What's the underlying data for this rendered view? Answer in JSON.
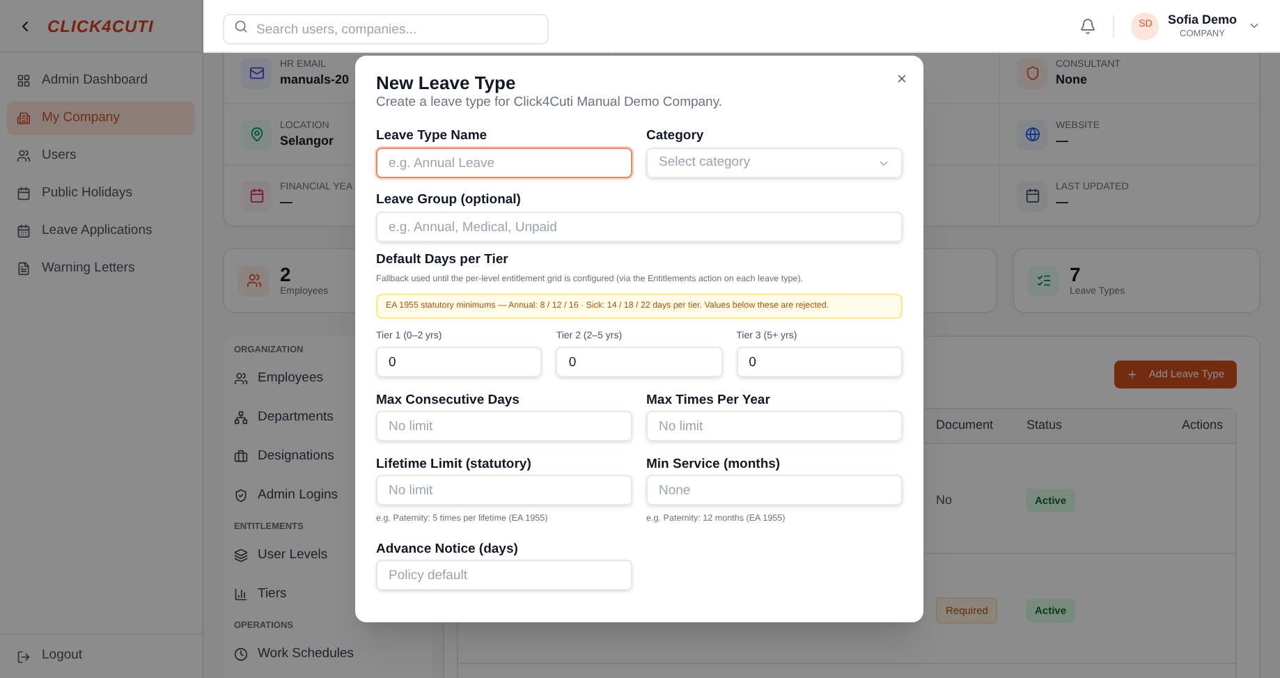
{
  "sidebar": {
    "logo": "CLICK4CUTI",
    "items": [
      {
        "label": "Admin Dashboard",
        "selected": false
      },
      {
        "label": "My Company",
        "selected": true
      },
      {
        "label": "Users",
        "selected": false
      },
      {
        "label": "Public Holidays",
        "selected": false
      },
      {
        "label": "Leave Applications",
        "selected": false
      },
      {
        "label": "Warning Letters",
        "selected": false
      }
    ],
    "logout": "Logout"
  },
  "topbar": {
    "search_placeholder": "Search users, companies...",
    "user": {
      "initials": "SD",
      "name": "Sofia Demo",
      "role": "COMPANY"
    }
  },
  "company_info": {
    "rows": [
      {
        "left": {
          "label": "HR EMAIL",
          "value": "manuals-20"
        },
        "right": {
          "label": "CONSULTANT",
          "value": "None"
        }
      },
      {
        "left": {
          "label": "LOCATION",
          "value": "Selangor"
        },
        "right": {
          "label": "WEBSITE",
          "value": "—"
        }
      },
      {
        "left": {
          "label": "FINANCIAL YEA",
          "value": "—"
        },
        "right": {
          "label": "LAST UPDATED",
          "value": "—"
        }
      }
    ]
  },
  "stats": [
    {
      "value": "2",
      "label": "Employees"
    },
    {
      "value": "7",
      "label": "Leave Types"
    }
  ],
  "settings_nav": [
    {
      "title": "ORGANIZATION",
      "items": [
        "Employees",
        "Departments",
        "Designations",
        "Admin Logins"
      ]
    },
    {
      "title": "ENTITLEMENTS",
      "items": [
        "User Levels",
        "Tiers"
      ]
    },
    {
      "title": "OPERATIONS",
      "items": [
        "Work Schedules"
      ]
    }
  ],
  "leave_types": {
    "add_button": "Add Leave Type",
    "columns": [
      "Document",
      "Status",
      "Actions"
    ],
    "rows": [
      {
        "document": "No",
        "document_required": false,
        "status": "Active"
      },
      {
        "document": "Required",
        "document_required": true,
        "status": "Active"
      }
    ]
  },
  "modal": {
    "title": "New Leave Type",
    "subtitle": "Create a leave type for Click4Cuti Manual Demo Company.",
    "name_field": {
      "label": "Leave Type Name",
      "placeholder": "e.g. Annual Leave",
      "focused": true
    },
    "category_field": {
      "label": "Category",
      "placeholder": "Select category"
    },
    "group_field": {
      "label": "Leave Group (optional)",
      "placeholder": "e.g. Annual, Medical, Unpaid"
    },
    "tiers": {
      "heading": "Default Days per Tier",
      "note": "Fallback used until the per-level entitlement grid is configured (via the Entitlements action on each leave type).",
      "warning": "EA 1955 statutory minimums — Annual: 8 / 12 / 16 · Sick: 14 / 18 / 22 days per tier. Values below these are rejected.",
      "items": [
        {
          "label": "Tier 1 (0–2 yrs)",
          "value": "0"
        },
        {
          "label": "Tier 2 (2–5 yrs)",
          "value": "0"
        },
        {
          "label": "Tier 3 (5+ yrs)",
          "value": "0"
        }
      ]
    },
    "limit_rows": [
      [
        {
          "label": "Max Consecutive Days",
          "placeholder": "No limit"
        },
        {
          "label": "Max Times Per Year",
          "placeholder": "No limit"
        }
      ],
      [
        {
          "label": "Lifetime Limit (statutory)",
          "placeholder": "No limit",
          "hint": "e.g. Paternity: 5 times per lifetime (EA 1955)"
        },
        {
          "label": "Min Service (months)",
          "placeholder": "None",
          "hint": "e.g. Paternity: 12 months (EA 1955)"
        }
      ],
      [
        {
          "label": "Advance Notice (days)",
          "placeholder": "Policy default"
        }
      ]
    ]
  }
}
